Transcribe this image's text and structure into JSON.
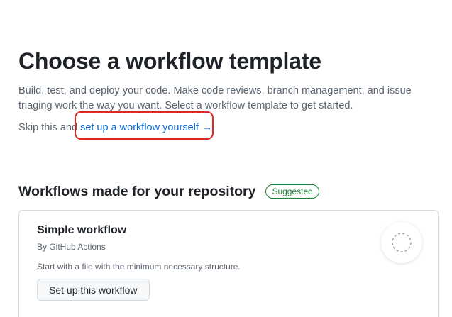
{
  "header": {
    "title": "Choose a workflow template",
    "description": "Build, test, and deploy your code. Make code reviews, branch management, and issue triaging work the way you want. Select a workflow template to get started.",
    "skip_prefix": "Skip this and",
    "skip_link": "set up a workflow yourself",
    "skip_arrow_icon": "arrow-right-icon"
  },
  "section": {
    "title": "Workflows made for your repository",
    "badge": "Suggested"
  },
  "card": {
    "title": "Simple workflow",
    "author": "By GitHub Actions",
    "description": "Start with a file with the minimum necessary structure.",
    "button_label": "Set up this workflow",
    "logo_icon": "dashed-circle-icon"
  },
  "colors": {
    "link": "#0969da",
    "highlight": "#e0281f",
    "badge": "#1a7f37"
  }
}
